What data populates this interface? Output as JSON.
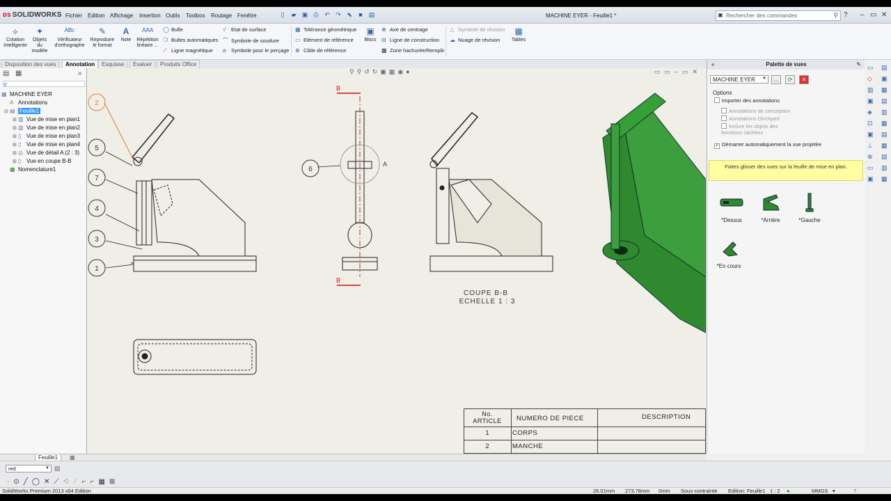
{
  "app": {
    "logo": "SOLIDWORKS",
    "doc_title": "MACHINE EYER - Feuille1 *"
  },
  "menu": [
    "Fichier",
    "Edition",
    "Affichage",
    "Insertion",
    "Outils",
    "Toolbox",
    "Routage",
    "Fenêtre"
  ],
  "search": {
    "placeholder": "Rechercher des commandes"
  },
  "ribbon": {
    "big": [
      {
        "label": "Cotation\nintelligente",
        "icon": "smart-dimension-icon"
      },
      {
        "label": "Objets\ndu\nmodèle",
        "icon": "model-items-icon"
      },
      {
        "label": "Vérificateur\nd'orthographe",
        "icon": "spell-check-icon"
      },
      {
        "label": "Reproduire\nle format",
        "icon": "format-painter-icon"
      },
      {
        "label": "Note",
        "icon": "note-icon"
      },
      {
        "label": "Répétition\nlinéaire ...",
        "icon": "linear-pattern-icon"
      }
    ],
    "col1": [
      "Bulle",
      "Bulles automatiques",
      "Ligne magnétique"
    ],
    "col2": [
      "Etat de surface",
      "Symbole de soudure",
      "Symbole pour le perçage"
    ],
    "col3": [
      "Tolérance géométrique",
      "Elément de référence",
      "Cible de référence"
    ],
    "blocs": "Blocs",
    "col4": [
      "Axe de centrage",
      "Ligne de construction",
      "Zone hachurée/Remplir"
    ],
    "col5": [
      "Symbole de révision",
      "Nuage de révision"
    ],
    "tables": "Tables"
  },
  "cmd_tabs": [
    "Disposition des vues",
    "Annotation",
    "Esquisse",
    "Evaluer",
    "Produits Office"
  ],
  "active_tab": "Annotation",
  "tree": [
    {
      "label": "MACHINE EYER",
      "level": 0
    },
    {
      "label": "Annotations",
      "level": 1
    },
    {
      "label": "Feuille1",
      "level": 1,
      "selected": true
    },
    {
      "label": "Vue de mise en plan1",
      "level": 2
    },
    {
      "label": "Vue de mise en plan2",
      "level": 2
    },
    {
      "label": "Vue de mise en plan3",
      "level": 2
    },
    {
      "label": "Vue de mise en plan4",
      "level": 2
    },
    {
      "label": "Vue de détail A (2 : 3)",
      "level": 2
    },
    {
      "label": "Vue en coupe B-B",
      "level": 2
    },
    {
      "label": "Nomenclature1",
      "level": 1
    }
  ],
  "drawing": {
    "balloons": [
      "2",
      "5",
      "7",
      "4",
      "3",
      "1"
    ],
    "balloon_6": "6",
    "detail_label": "A",
    "section_label": "B",
    "section_title": "COUPE B-B",
    "section_scale": "ECHELLE 1 : 3"
  },
  "bom": {
    "headers": [
      "No.\nARTICLE",
      "NUMERO DE PIECE",
      "DESCRIPTION"
    ],
    "rows": [
      [
        "1",
        "CORPS",
        ""
      ],
      [
        "2",
        "MANCHE",
        ""
      ]
    ]
  },
  "palette": {
    "title": "Palette de vues",
    "model": "MACHINE EYER",
    "options_title": "Options",
    "options": [
      {
        "label": "Importer des annotations",
        "checked": false,
        "disabled": false
      },
      {
        "label": "Annotations de conception",
        "checked": false,
        "disabled": true
      },
      {
        "label": "Annotations DimXpert",
        "checked": false,
        "disabled": true
      },
      {
        "label": "Inclure les objets des fonctions cachées",
        "checked": false,
        "disabled": true
      },
      {
        "label": "Démarrer automatiquement la vue projetée",
        "checked": true,
        "disabled": false
      }
    ],
    "tip": "Faites glisser des vues sur la feuille de mise en plan.",
    "views": [
      "*Dessus",
      "*Arrière",
      "*Gauche",
      "*En cours"
    ]
  },
  "sheet_tab": "Feuille1",
  "layer": "red",
  "status": {
    "product": "SolidWorks Premium 2013 x64 Edition",
    "x": "26.01mm",
    "y": "273.78mm",
    "z": "0mm",
    "state": "Sous-contrainte",
    "edit": "Edition: Feuille1",
    "scale": "1 : 2",
    "units": "MMGS"
  },
  "colors": {
    "accent": "#3366aa",
    "model_green": "#2f8a2f",
    "section_red": "#cc1111",
    "tip_bg": "#fffea0"
  }
}
